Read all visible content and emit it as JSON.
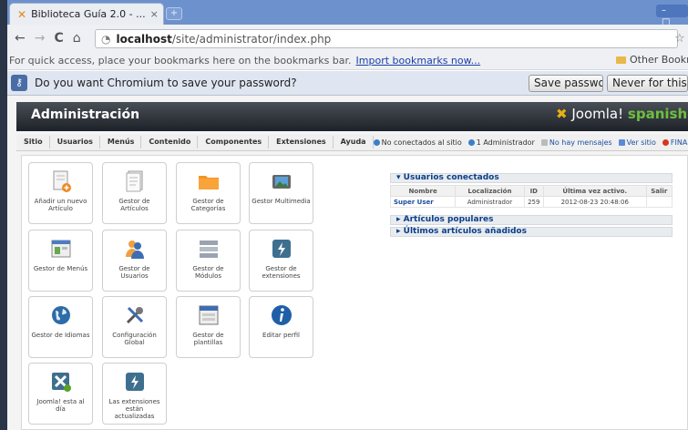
{
  "browser": {
    "tab_title": "Biblioteca Guía 2.0 - ...",
    "tab_close": "×",
    "new_tab": "+",
    "window_controls": "– □",
    "nav": {
      "back": "←",
      "forward": "→",
      "reload": "C",
      "home": "⌂"
    },
    "url_host": "localhost",
    "url_path": "/site/administrator/index.php",
    "star": "☆",
    "bookmarks_bar_text": "For quick access, place your bookmarks here on the bookmarks bar.",
    "bookmarks_link": "Import bookmarks now...",
    "other_bookmarks": "Other Bookm",
    "infobar_text": "Do you want Chromium to save your password?",
    "save_password": "Save password",
    "never_for_site": "Never for this sit"
  },
  "admin": {
    "title": "Administración",
    "logo_text": "Joomla!",
    "logo_suffix": "spanish"
  },
  "menu": [
    "Sitio",
    "Usuarios",
    "Menús",
    "Contenido",
    "Componentes",
    "Extensiones",
    "Ayuda"
  ],
  "status": {
    "not_connected": "No conectados al sitio",
    "admins": "1 Administrador",
    "messages": "No hay mensajes",
    "view_site": "Ver sitio",
    "logout": "FINALIZA"
  },
  "quickicons": [
    {
      "label": "Añadir un nuevo Artículo",
      "icon": "add-article-icon"
    },
    {
      "label": "Gestor de Artículos",
      "icon": "article-manager-icon"
    },
    {
      "label": "Gestor de Categorías",
      "icon": "folder-icon"
    },
    {
      "label": "Gestor Multimedia",
      "icon": "media-icon"
    },
    {
      "label": "Gestor de Menús",
      "icon": "menu-manager-icon"
    },
    {
      "label": "Gestor de Usuarios",
      "icon": "users-icon"
    },
    {
      "label": "Gestor de Módulos",
      "icon": "modules-icon"
    },
    {
      "label": "Gestor de extensiones",
      "icon": "extensions-icon"
    },
    {
      "label": "Gestor de Idiomas",
      "icon": "globe-icon"
    },
    {
      "label": "Configuración Global",
      "icon": "tools-icon"
    },
    {
      "label": "Gestor de plantillas",
      "icon": "templates-icon"
    },
    {
      "label": "Editar perfil",
      "icon": "info-icon"
    },
    {
      "label": "Joomla! esta al día",
      "icon": "joomla-update-icon"
    },
    {
      "label": "Las extensiones están actualizadas",
      "icon": "extensions-update-icon"
    }
  ],
  "panel": {
    "logged_users_title": "Usuarios conectados",
    "columns": [
      "Nombre",
      "Localización",
      "ID",
      "Última vez activo.",
      "Salir"
    ],
    "rows": [
      [
        "Super User",
        "Administrador",
        "259",
        "2012-08-23 20:48:06",
        ""
      ]
    ],
    "popular_title": "Artículos populares",
    "latest_title": "Últimos artículos añadidos"
  },
  "colors": {
    "tabstrip": "#6d91cd",
    "admin_bar": "#2b3038",
    "link_blue": "#1d4fa0",
    "joomla_orange": "#e6b012",
    "spanish_green": "#6fbe3e"
  }
}
